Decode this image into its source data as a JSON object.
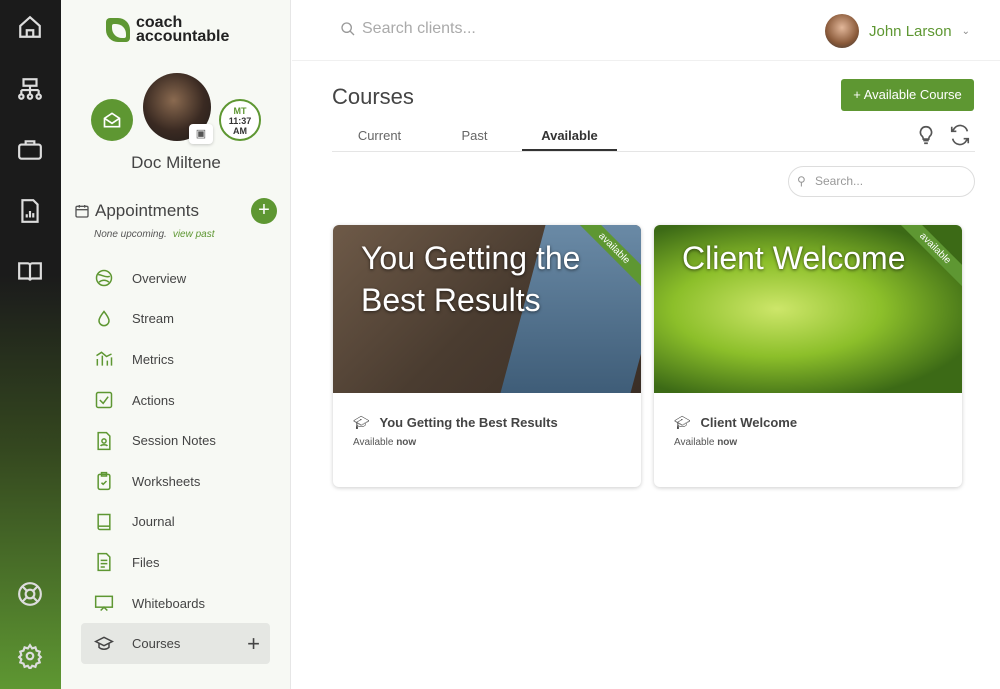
{
  "rail": {
    "icons": [
      "home-icon",
      "org-chart-icon",
      "briefcase-icon",
      "report-icon",
      "book-icon",
      "lifebuoy-icon",
      "gear-icon"
    ]
  },
  "sidebar": {
    "logo": "coach accountable",
    "client_name": "Doc Miltene",
    "clock": {
      "tz": "MT",
      "time": "11:37",
      "ampm": "AM"
    },
    "appointments": {
      "title": "Appointments",
      "none": "None upcoming.",
      "view_past": "view past"
    },
    "items": [
      {
        "label": "Overview"
      },
      {
        "label": "Stream"
      },
      {
        "label": "Metrics"
      },
      {
        "label": "Actions"
      },
      {
        "label": "Session Notes"
      },
      {
        "label": "Worksheets"
      },
      {
        "label": "Journal"
      },
      {
        "label": "Files"
      },
      {
        "label": "Whiteboards"
      },
      {
        "label": "Courses",
        "active": true
      }
    ]
  },
  "header": {
    "search_placeholder": "Search clients...",
    "user": "John Larson"
  },
  "main": {
    "title": "Courses",
    "add_button": "+ Available Course",
    "tabs": [
      {
        "label": "Current"
      },
      {
        "label": "Past"
      },
      {
        "label": "Available",
        "active": true
      }
    ],
    "search_placeholder": "Search...",
    "cards": [
      {
        "image_title": "You Getting the Best Results",
        "ribbon": "available",
        "title": "You Getting the Best Results",
        "avail": "Available",
        "when": "now"
      },
      {
        "image_title": "Client Welcome",
        "ribbon": "available",
        "title": "Client Welcome",
        "avail": "Available",
        "when": "now"
      }
    ]
  },
  "colors": {
    "accent": "#5e9732"
  }
}
